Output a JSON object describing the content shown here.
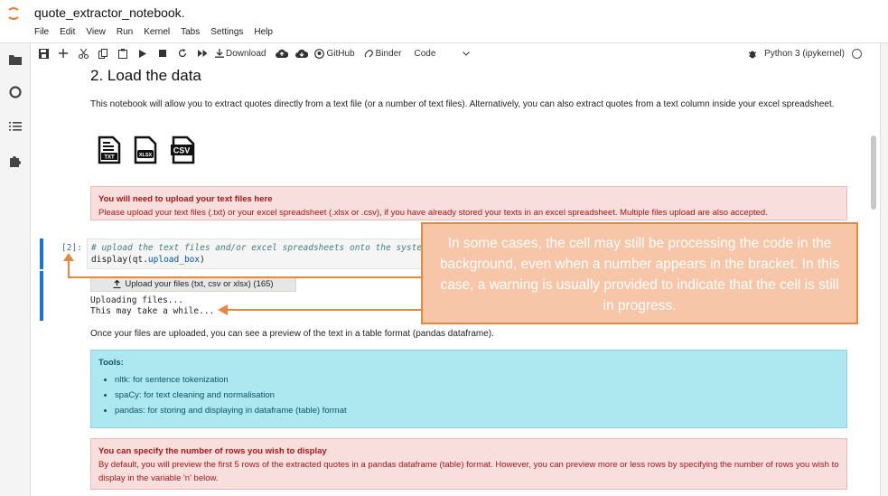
{
  "app": {
    "notebook_title": "quote_extractor_notebook.",
    "menu": [
      "File",
      "Edit",
      "View",
      "Run",
      "Kernel",
      "Tabs",
      "Settings",
      "Help"
    ]
  },
  "toolbar": {
    "download_label": "Download",
    "github_label": "GitHub",
    "binder_label": "Binder",
    "cell_type": "Code",
    "kernel_name": "Python 3 (ipykernel)"
  },
  "sidebar": {
    "icons": [
      "folder-icon",
      "running-icon",
      "toc-icon",
      "extension-icon"
    ]
  },
  "notebook": {
    "heading": "2. Load the data",
    "intro": "This notebook will allow you to extract quotes directly from a text file (or a number of text files). Alternatively, you can also extract quotes from a text column inside your excel spreadsheet.",
    "file_icon_labels": [
      "TXT",
      "XLSX",
      "CSV"
    ],
    "upload_alert": {
      "title": "You will need to upload your text files here",
      "text": "Please upload your text files (.txt) or your excel spreadsheet (.xlsx or .csv), if you have already stored your texts in an excel spreadsheet. Multiple files upload are also accepted."
    },
    "code_cell": {
      "prompt": "[2]:",
      "line1_comment": "# upload the text files and/or excel spreadsheets onto the system",
      "line2_prefix": "display(qt.",
      "line2_attr": "upload_box",
      "line2_suffix": ")"
    },
    "output": {
      "upload_button": "Upload your files (txt, csv or xlsx) (165)",
      "line1": "Uploading files...",
      "line2": "This may take a while..."
    },
    "after_upload": "Once your files are uploaded, you can see a preview of the text in a table format (pandas dataframe).",
    "tools_alert": {
      "title": "Tools:",
      "items": [
        "nltk: for sentence tokenization",
        "spaCy: for text cleaning and normalisation",
        "pandas: for storing and displaying in dataframe (table) format"
      ]
    },
    "rows_alert": {
      "title": "You can specify the number of rows you wish to display",
      "text": "By default, you will preview the first 5 rows of the extracted quotes in a pandas dataframe (table) format. However, you can preview more or less rows by specifying the number of rows you wish to display in the variable 'n' below."
    }
  },
  "annotation": {
    "text": "In some cases, the cell may still be processing the code in the background, even when a number appears in the bracket. In this case, a warning is usually provided to indicate that the cell is still in progress.",
    "color": "#e8883e"
  }
}
